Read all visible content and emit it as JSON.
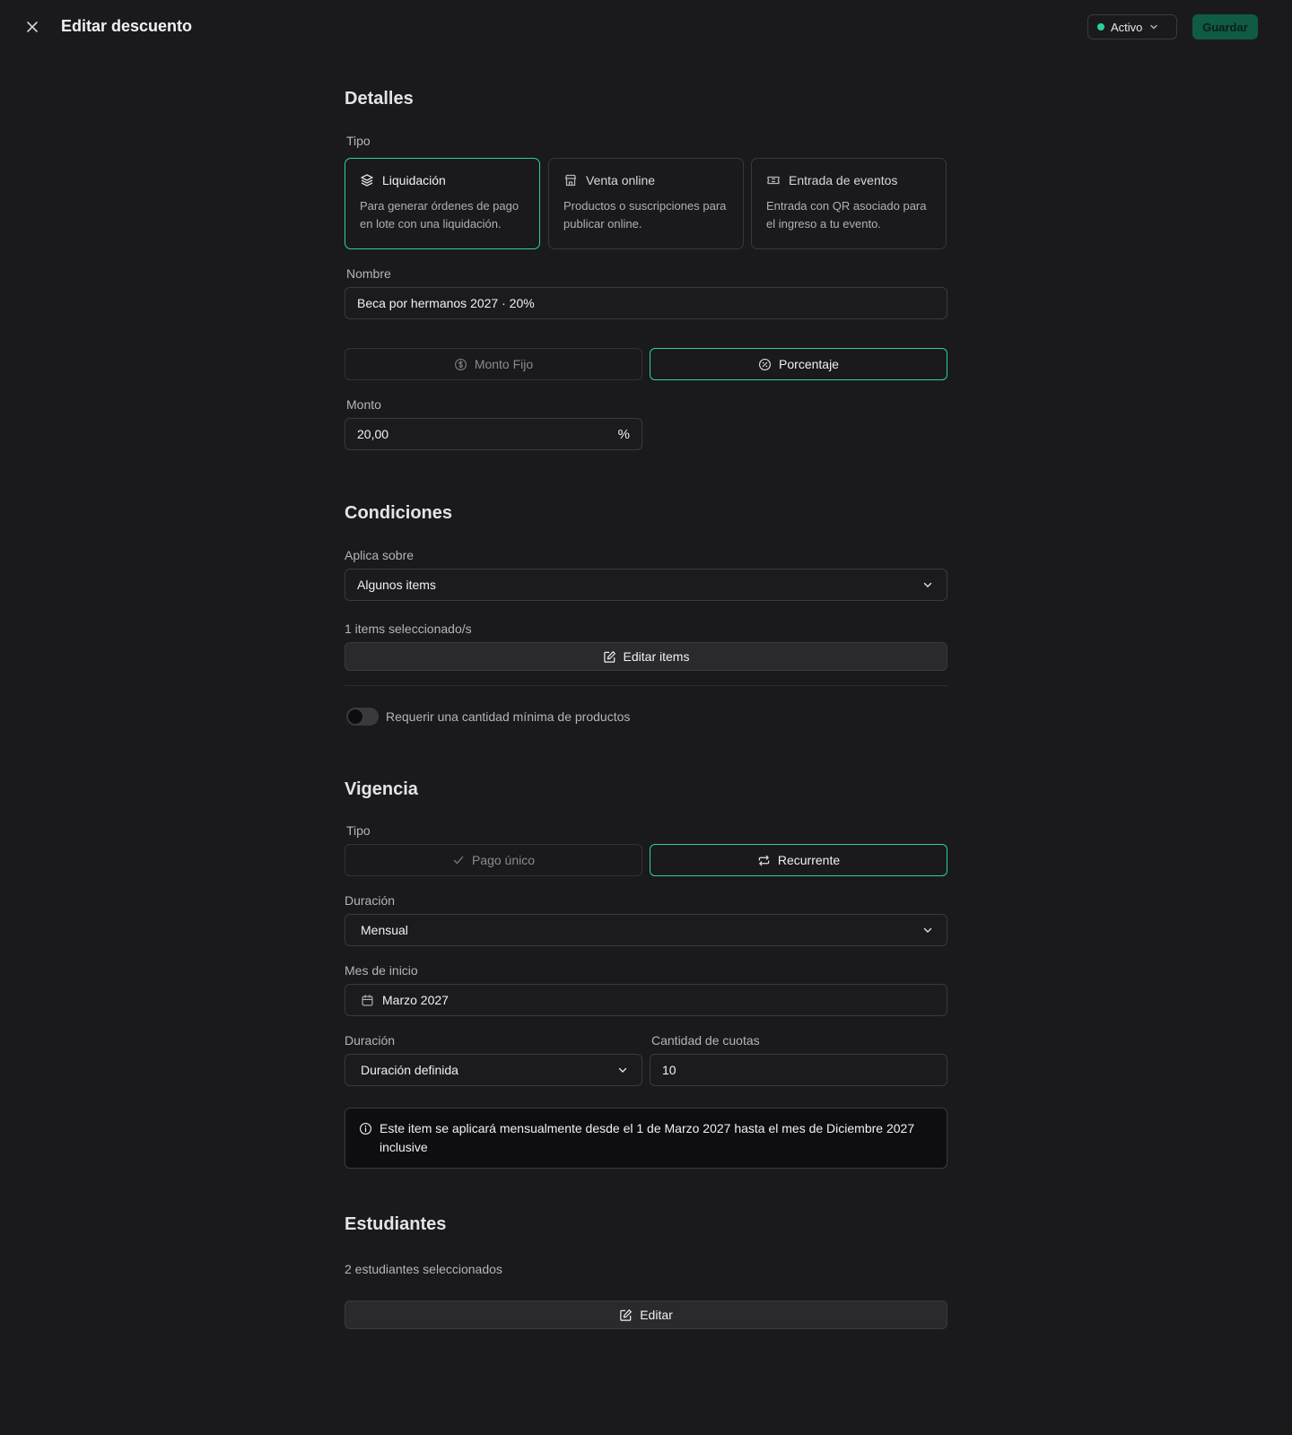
{
  "header": {
    "title": "Editar descuento",
    "status_label": "Activo",
    "save_label": "Guardar",
    "status_color": "#2bd19a"
  },
  "detalles": {
    "title": "Detalles",
    "tipo_label": "Tipo",
    "types": [
      {
        "title": "Liquidación",
        "desc": "Para generar órdenes de pago en lote con una liquidación.",
        "icon": "layers-icon",
        "selected": true
      },
      {
        "title": "Venta online",
        "desc": "Productos o suscripciones para publicar online.",
        "icon": "store-icon",
        "selected": false
      },
      {
        "title": "Entrada de eventos",
        "desc": "Entrada con QR asociado para el ingreso a tu evento.",
        "icon": "ticket-icon",
        "selected": false
      }
    ],
    "nombre_label": "Nombre",
    "nombre_value": "Beca por hermanos 2027 · 20%",
    "discount_modes": [
      {
        "label": "Monto Fijo",
        "icon": "dollar-circle-icon",
        "active": false
      },
      {
        "label": "Porcentaje",
        "icon": "percent-circle-icon",
        "active": true
      }
    ],
    "monto_label": "Monto",
    "monto_value": "20,00",
    "monto_suffix": "%"
  },
  "condiciones": {
    "title": "Condiciones",
    "aplica_label": "Aplica sobre",
    "aplica_value": "Algunos items",
    "selected_count_text": "1 items seleccionado/s",
    "edit_items_label": "Editar items",
    "min_qty_label": "Requerir una cantidad mínima de productos",
    "min_qty_enabled": false
  },
  "vigencia": {
    "title": "Vigencia",
    "tipo_label": "Tipo",
    "modes": [
      {
        "label": "Pago único",
        "icon": "check-icon",
        "active": false
      },
      {
        "label": "Recurrente",
        "icon": "repeat-icon",
        "active": true
      }
    ],
    "duracion_label": "Duración",
    "duracion_value": "Mensual",
    "mes_inicio_label": "Mes de inicio",
    "mes_inicio_value": "Marzo 2027",
    "duracion2_label": "Duración",
    "duracion2_value": "Duración definida",
    "cuotas_label": "Cantidad de cuotas",
    "cuotas_value": "10",
    "info_text": "Este item se aplicará mensualmente desde el 1 de Marzo 2027 hasta el mes de Diciembre 2027 inclusive"
  },
  "estudiantes": {
    "title": "Estudiantes",
    "count_text": "2 estudiantes seleccionados",
    "edit_label": "Editar"
  },
  "colors": {
    "accent": "#2bd19a",
    "background": "#1a1a1c",
    "save_bg": "#0f5b45"
  }
}
